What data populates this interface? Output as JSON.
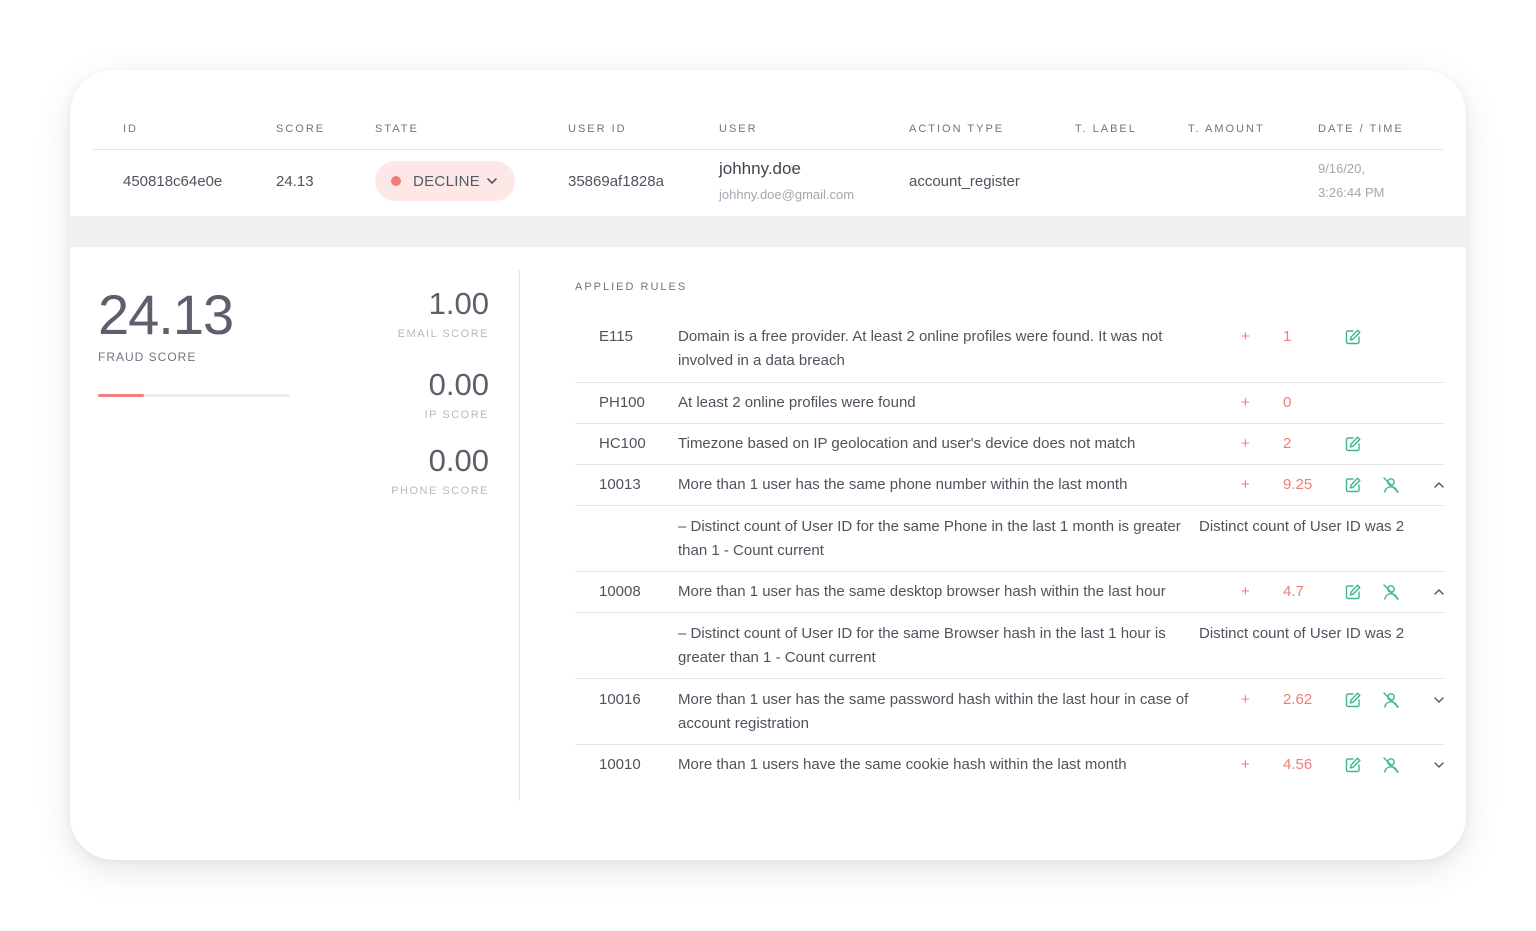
{
  "table": {
    "headers": {
      "id": "ID",
      "score": "SCORE",
      "state": "STATE",
      "user_id": "USER ID",
      "user": "USER",
      "action_type": "ACTION TYPE",
      "t_label": "T. LABEL",
      "t_amount": "T. AMOUNT",
      "date_time": "DATE / TIME"
    },
    "row": {
      "id": "450818c64e0e",
      "score": "24.13",
      "state": "DECLINE",
      "user_id": "35869af1828a",
      "user_name": "johhny.doe",
      "user_email": "johhny.doe@gmail.com",
      "action_type": "account_register",
      "t_label": "",
      "t_amount": "",
      "date": "9/16/20,",
      "time": "3:26:44 PM"
    }
  },
  "scores": {
    "fraud_score": "24.13",
    "fraud_label": "FRAUD SCORE",
    "fraud_bar_fraction": 0.2413,
    "email_score": "1.00",
    "email_label": "EMAIL SCORE",
    "ip_score": "0.00",
    "ip_label": "IP SCORE",
    "phone_score": "0.00",
    "phone_label": "PHONE SCORE"
  },
  "rules": {
    "title": "APPLIED RULES",
    "items": [
      {
        "code": "E115",
        "desc": "Domain is a free provider. At least 2 online profiles were found. It was not involved in a data breach",
        "sign": "+",
        "points": "1"
      },
      {
        "code": "PH100",
        "desc": "At least 2 online profiles were found",
        "sign": "+",
        "points": "0"
      },
      {
        "code": "HC100",
        "desc": "Timezone based on IP geolocation and user's device does not match",
        "sign": "+",
        "points": "2"
      },
      {
        "code": "10013",
        "desc": "More than 1 user has the same phone number within the last month",
        "sign": "+",
        "points": "9.25",
        "detail_left": "– Distinct count of User ID for the same Phone in the last 1 month is greater than 1 - Count current",
        "detail_right": "Distinct count of User ID was 2"
      },
      {
        "code": "10008",
        "desc": "More than 1 user has the same desktop browser hash within the last hour",
        "sign": "+",
        "points": "4.7",
        "detail_left": "– Distinct count of User ID for the same Browser hash in the last 1 hour is greater than 1 - Count current",
        "detail_right": "Distinct count of User ID was 2"
      },
      {
        "code": "10016",
        "desc": "More than 1 user has the same password hash within the last hour in case of account registration",
        "sign": "+",
        "points": "2.62"
      },
      {
        "code": "10010",
        "desc": "More than 1 users have the same cookie hash within the last month",
        "sign": "+",
        "points": "4.56"
      }
    ]
  },
  "colors": {
    "accent_red": "#f07b7b",
    "icon_green": "#3fb38f",
    "pill_bg": "#fde7e7"
  },
  "icons": {
    "edit": "edit-icon",
    "block_user": "block-user-icon",
    "chevron_up": "chevron-up-icon",
    "chevron_down": "chevron-down-icon"
  }
}
